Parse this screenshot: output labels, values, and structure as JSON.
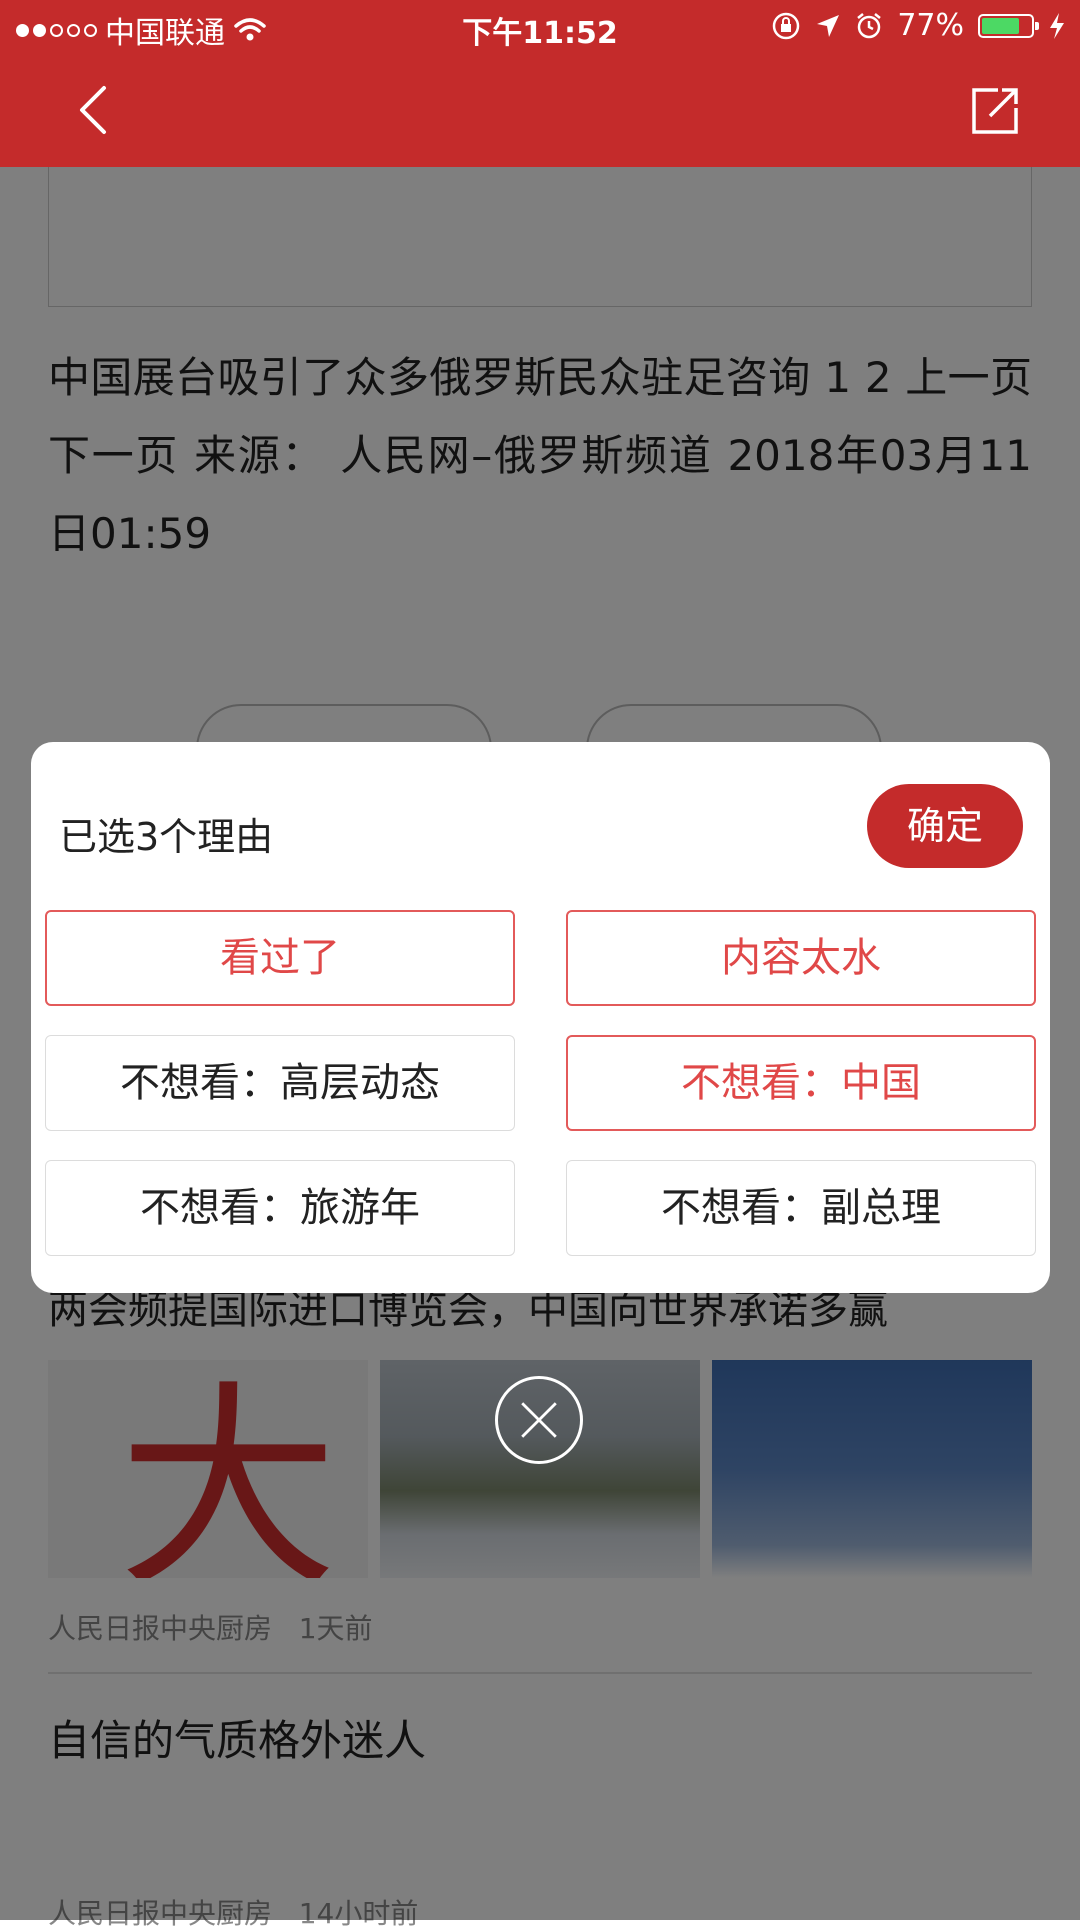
{
  "status_bar": {
    "carrier": "中国联通",
    "time": "下午11:52",
    "battery": "77%",
    "battery_level": 0.77
  },
  "nav": {
    "back_icon": "chevron-left-icon",
    "share_icon": "share-icon"
  },
  "article": {
    "body": "中国展台吸引了众多俄罗斯民众驻足咨询 1 2 上一页 下一页 来源： 人民网–俄罗斯频道 2018年03月11日01:59"
  },
  "feed": {
    "item1": {
      "title": "两会频提国际进口博览会，中国向世界承诺多赢",
      "source": "人民日报中央厨房",
      "time": "1天前",
      "thumb1_text": "大"
    },
    "item2": {
      "title": "自信的气质格外迷人",
      "source": "人民日报中央厨房",
      "time": "14小时前"
    }
  },
  "dialog": {
    "title": "已选3个理由",
    "confirm_label": "确定",
    "reasons": [
      {
        "label": "看过了",
        "selected": true
      },
      {
        "label": "内容太水",
        "selected": true
      },
      {
        "label": "不想看：高层动态",
        "selected": false
      },
      {
        "label": "不想看：中国",
        "selected": true
      },
      {
        "label": "不想看：旅游年",
        "selected": false
      },
      {
        "label": "不想看：副总理",
        "selected": false
      }
    ]
  },
  "colors": {
    "brand_red": "#c42b2b",
    "selected_red": "#e04848"
  }
}
